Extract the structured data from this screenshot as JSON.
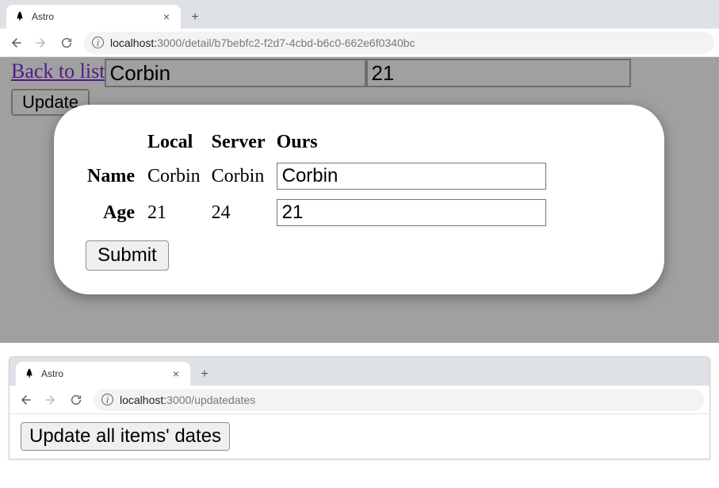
{
  "window1": {
    "tab_title": "Astro",
    "url_host": "localhost:",
    "url_port_path": "3000/detail/b7bebfc2-f2d7-4cbd-b6c0-662e6f0340bc",
    "back_link": "Back to list",
    "top_name_value": "Corbin",
    "top_age_value": "21",
    "update_label": "Update",
    "modal": {
      "col_local": "Local",
      "col_server": "Server",
      "col_ours": "Ours",
      "row_name": "Name",
      "row_age": "Age",
      "name_local": "Corbin",
      "name_server": "Corbin",
      "name_ours": "Corbin",
      "age_local": "21",
      "age_server": "24",
      "age_ours": "21",
      "submit_label": "Submit"
    }
  },
  "window2": {
    "tab_title": "Astro",
    "url_host": "localhost:",
    "url_port_path": "3000/updatedates",
    "button_label": "Update all items' dates"
  }
}
